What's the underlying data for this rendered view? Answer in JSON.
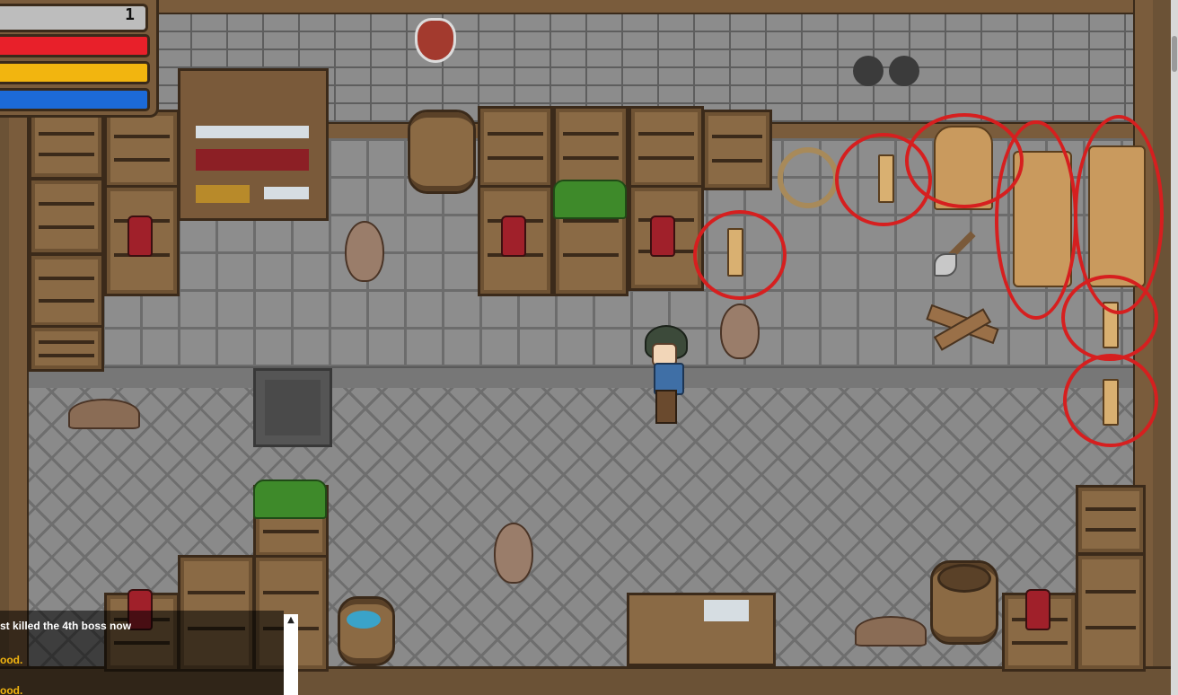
{
  "hud": {
    "level": "1",
    "health_fraction": 1.0,
    "stamina_fraction": 1.0,
    "mana_fraction": 1.0,
    "colors": {
      "health": "#e8202a",
      "stamina": "#f2b50f",
      "mana": "#1c6ad8"
    }
  },
  "chat": {
    "messages": [
      {
        "text": "st killed the 4th boss now",
        "color": "#ffffff"
      },
      {
        "text": "ood.",
        "color": "#f2b50f"
      },
      {
        "text": "ood.",
        "color": "#f2b50f"
      }
    ],
    "scroll_up_glyph": "▲"
  },
  "scene": {
    "location": "storeroom",
    "highlight_color": "#d61f1f",
    "highlight_count": 7,
    "highlighted_items": [
      "wood-stick",
      "wood-stick",
      "log-pile",
      "log-pile",
      "log-pile",
      "wood-stick",
      "wood-stick"
    ]
  }
}
